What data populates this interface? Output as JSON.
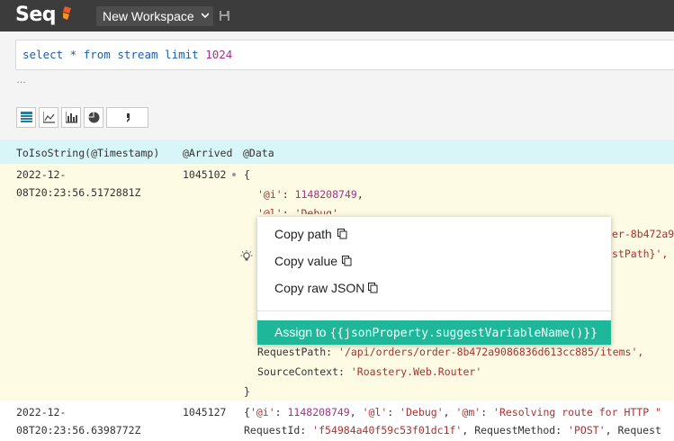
{
  "app": {
    "logo_text": "Seq",
    "workspace_label": "New Workspace"
  },
  "query": {
    "text_prefix": "select * from stream limit ",
    "text_limit": "1024",
    "more": "…"
  },
  "viz_buttons": [
    "table-icon",
    "line-chart-icon",
    "bar-chart-icon",
    "pie-chart-icon",
    "comma-icon"
  ],
  "results": {
    "columns": [
      "ToIsoString(@Timestamp)",
      "@Arrived",
      "@Data"
    ],
    "row1": {
      "ts_line1": "2022-12-",
      "ts_line2": "08T20:23:56.5172881Z",
      "arrived": "1045102",
      "open_brace": "{",
      "i_key": "'@i'",
      "i_val": "1148208749",
      "l_key": "'@l'",
      "l_val": "'Debug',",
      "frag1": "er-8b472a9",
      "frag2": "stPath}',",
      "path_key": "RequestPath",
      "path_val": "'/api/orders/order-8b472a9086836d613cc885/items',",
      "ctx_key": "SourceContext",
      "ctx_val": "'Roastery.Web.Router'",
      "close_brace": "}"
    },
    "row2": {
      "ts_line1": "2022-12-",
      "ts_line2": "08T20:23:56.6398772Z",
      "arrived": "1045127",
      "line1_a": "{",
      "line1_ikey": "'@i'",
      "line1_ival": "1148208749",
      "line1_lkey": "'@l'",
      "line1_lval": "'Debug'",
      "line1_mkey": "'@m'",
      "line1_mval": "'Resolving route for HTTP \"",
      "line2_rkey": "RequestId",
      "line2_rval": "'f54984a40f59c53f01dc1f'",
      "line2_mkey": "RequestMethod",
      "line2_mval": "'POST'",
      "line2_tail": "Request"
    }
  },
  "context_menu": {
    "copy_path": "Copy path",
    "copy_value": "Copy value",
    "copy_raw_json": "Copy raw JSON",
    "assign_prefix": "Assign to ",
    "assign_code": "{{jsonProperty.suggestVariableName()}}"
  },
  "colors": {
    "topbar": "#3c3c3c",
    "header_row": "#d8f5f7",
    "selected_row": "#fdfbe3",
    "accent": "#1fb799",
    "string": "#a83232",
    "number": "#a4318f"
  }
}
